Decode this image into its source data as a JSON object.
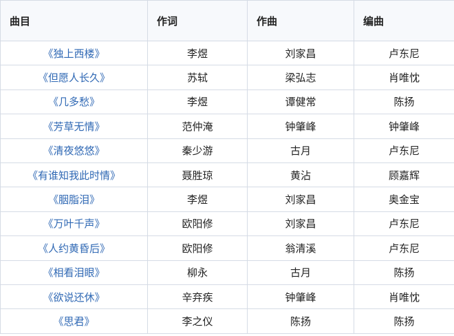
{
  "headers": {
    "song": "曲目",
    "lyricist": "作词",
    "composer": "作曲",
    "arranger": "编曲"
  },
  "rows": [
    {
      "song": "《独上西楼》",
      "lyricist": "李煜",
      "composer": "刘家昌",
      "arranger": "卢东尼"
    },
    {
      "song": "《但愿人长久》",
      "lyricist": "苏轼",
      "composer": "梁弘志",
      "arranger": "肖唯忱"
    },
    {
      "song": "《几多愁》",
      "lyricist": "李煜",
      "composer": "谭健常",
      "arranger": "陈扬"
    },
    {
      "song": "《芳草无情》",
      "lyricist": "范仲淹",
      "composer": "钟肇峰",
      "arranger": "钟肇峰"
    },
    {
      "song": "《清夜悠悠》",
      "lyricist": "秦少游",
      "composer": "古月",
      "arranger": "卢东尼"
    },
    {
      "song": "《有谁知我此时情》",
      "lyricist": "聂胜琼",
      "composer": "黄沾",
      "arranger": "顾嘉辉"
    },
    {
      "song": "《胭脂泪》",
      "lyricist": "李煜",
      "composer": "刘家昌",
      "arranger": "奥金宝"
    },
    {
      "song": "《万叶千声》",
      "lyricist": "欧阳修",
      "composer": "刘家昌",
      "arranger": "卢东尼"
    },
    {
      "song": "《人约黄昏后》",
      "lyricist": "欧阳修",
      "composer": "翁清溪",
      "arranger": "卢东尼"
    },
    {
      "song": "《相看泪眼》",
      "lyricist": "柳永",
      "composer": "古月",
      "arranger": "陈扬"
    },
    {
      "song": "《欲说还休》",
      "lyricist": "辛弃疾",
      "composer": "钟肇峰",
      "arranger": "肖唯忱"
    },
    {
      "song": "《思君》",
      "lyricist": "李之仪",
      "composer": "陈扬",
      "arranger": "陈扬"
    }
  ],
  "colors": {
    "link": "#2f68b4",
    "border": "#d5dbe5",
    "header_bg": "#f7f9fc"
  }
}
